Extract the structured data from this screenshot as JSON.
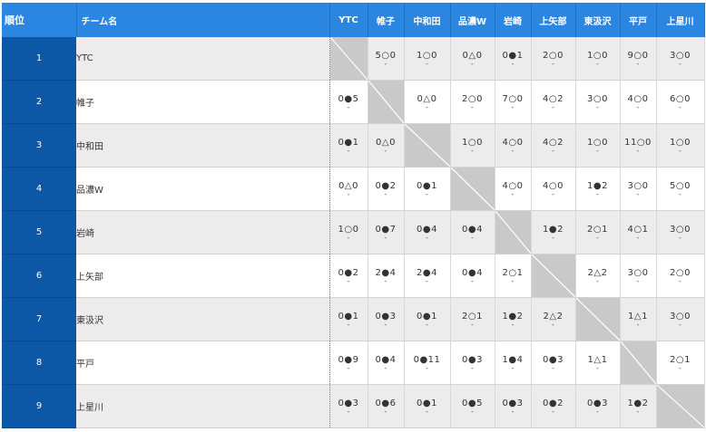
{
  "header": {
    "rank": "順位",
    "team": "チーム名",
    "opponents": [
      "YTC",
      "帷子",
      "中和田",
      "品濃W",
      "岩崎",
      "上矢部",
      "東汲沢",
      "平戸",
      "上星川"
    ]
  },
  "rows": [
    {
      "rank": "1",
      "team": "YTC",
      "results": [
        {
          "diag": true
        },
        {
          "score": "5○0",
          "sub": "-"
        },
        {
          "score": "1○0",
          "sub": "-"
        },
        {
          "score": "0△0",
          "sub": "-"
        },
        {
          "score": "0●1",
          "sub": "-"
        },
        {
          "score": "2○0",
          "sub": "-"
        },
        {
          "score": "1○0",
          "sub": "-"
        },
        {
          "score": "9○0",
          "sub": "-"
        },
        {
          "score": "3○0",
          "sub": "-"
        }
      ]
    },
    {
      "rank": "2",
      "team": "帷子",
      "results": [
        {
          "score": "0●5",
          "sub": "-"
        },
        {
          "diag": true
        },
        {
          "score": "0△0",
          "sub": "-"
        },
        {
          "score": "2○0",
          "sub": "-"
        },
        {
          "score": "7○0",
          "sub": "-"
        },
        {
          "score": "4○2",
          "sub": "-"
        },
        {
          "score": "3○0",
          "sub": "-"
        },
        {
          "score": "4○0",
          "sub": "-"
        },
        {
          "score": "6○0",
          "sub": "-"
        }
      ]
    },
    {
      "rank": "3",
      "team": "中和田",
      "results": [
        {
          "score": "0●1",
          "sub": "-"
        },
        {
          "score": "0△0",
          "sub": "-"
        },
        {
          "diag": true
        },
        {
          "score": "1○0",
          "sub": "-"
        },
        {
          "score": "4○0",
          "sub": "-"
        },
        {
          "score": "4○2",
          "sub": "-"
        },
        {
          "score": "1○0",
          "sub": "-"
        },
        {
          "score": "11○0",
          "sub": "-"
        },
        {
          "score": "1○0",
          "sub": "-"
        }
      ]
    },
    {
      "rank": "4",
      "team": "品濃W",
      "results": [
        {
          "score": "0△0",
          "sub": "-"
        },
        {
          "score": "0●2",
          "sub": "-"
        },
        {
          "score": "0●1",
          "sub": "-"
        },
        {
          "diag": true
        },
        {
          "score": "4○0",
          "sub": "-"
        },
        {
          "score": "4○0",
          "sub": "-"
        },
        {
          "score": "1●2",
          "sub": "-"
        },
        {
          "score": "3○0",
          "sub": "-"
        },
        {
          "score": "5○0",
          "sub": "-"
        }
      ]
    },
    {
      "rank": "5",
      "team": "岩崎",
      "results": [
        {
          "score": "1○0",
          "sub": "-"
        },
        {
          "score": "0●7",
          "sub": "-"
        },
        {
          "score": "0●4",
          "sub": "-"
        },
        {
          "score": "0●4",
          "sub": "-"
        },
        {
          "diag": true
        },
        {
          "score": "1●2",
          "sub": "-"
        },
        {
          "score": "2○1",
          "sub": "-"
        },
        {
          "score": "4○1",
          "sub": "-"
        },
        {
          "score": "3○0",
          "sub": "-"
        }
      ]
    },
    {
      "rank": "6",
      "team": "上矢部",
      "results": [
        {
          "score": "0●2",
          "sub": "-"
        },
        {
          "score": "2●4",
          "sub": "-"
        },
        {
          "score": "2●4",
          "sub": "-"
        },
        {
          "score": "0●4",
          "sub": "-"
        },
        {
          "score": "2○1",
          "sub": "-"
        },
        {
          "diag": true
        },
        {
          "score": "2△2",
          "sub": "-"
        },
        {
          "score": "3○0",
          "sub": "-"
        },
        {
          "score": "2○0",
          "sub": "-"
        }
      ]
    },
    {
      "rank": "7",
      "team": "東汲沢",
      "results": [
        {
          "score": "0●1",
          "sub": "-"
        },
        {
          "score": "0●3",
          "sub": "-"
        },
        {
          "score": "0●1",
          "sub": "-"
        },
        {
          "score": "2○1",
          "sub": "-"
        },
        {
          "score": "1●2",
          "sub": "-"
        },
        {
          "score": "2△2",
          "sub": "-"
        },
        {
          "diag": true
        },
        {
          "score": "1△1",
          "sub": "-"
        },
        {
          "score": "3○0",
          "sub": "-"
        }
      ]
    },
    {
      "rank": "8",
      "team": "平戸",
      "results": [
        {
          "score": "0●9",
          "sub": "-"
        },
        {
          "score": "0●4",
          "sub": "-"
        },
        {
          "score": "0●11",
          "sub": "-"
        },
        {
          "score": "0●3",
          "sub": "-"
        },
        {
          "score": "1●4",
          "sub": "-"
        },
        {
          "score": "0●3",
          "sub": "-"
        },
        {
          "score": "1△1",
          "sub": "-"
        },
        {
          "diag": true
        },
        {
          "score": "2○1",
          "sub": "-"
        }
      ]
    },
    {
      "rank": "9",
      "team": "上星川",
      "results": [
        {
          "score": "0●3",
          "sub": "-"
        },
        {
          "score": "0●6",
          "sub": "-"
        },
        {
          "score": "0●1",
          "sub": "-"
        },
        {
          "score": "0●5",
          "sub": "-"
        },
        {
          "score": "0●3",
          "sub": "-"
        },
        {
          "score": "0●2",
          "sub": "-"
        },
        {
          "score": "0●3",
          "sub": "-"
        },
        {
          "score": "1●2",
          "sub": "-"
        },
        {
          "diag": true
        }
      ]
    }
  ],
  "colors": {
    "header_bg": "#2b86e2",
    "rank_bg": "#0c57a6",
    "diag_bg": "#c9c9c9",
    "odd_row_bg": "#ececec"
  }
}
